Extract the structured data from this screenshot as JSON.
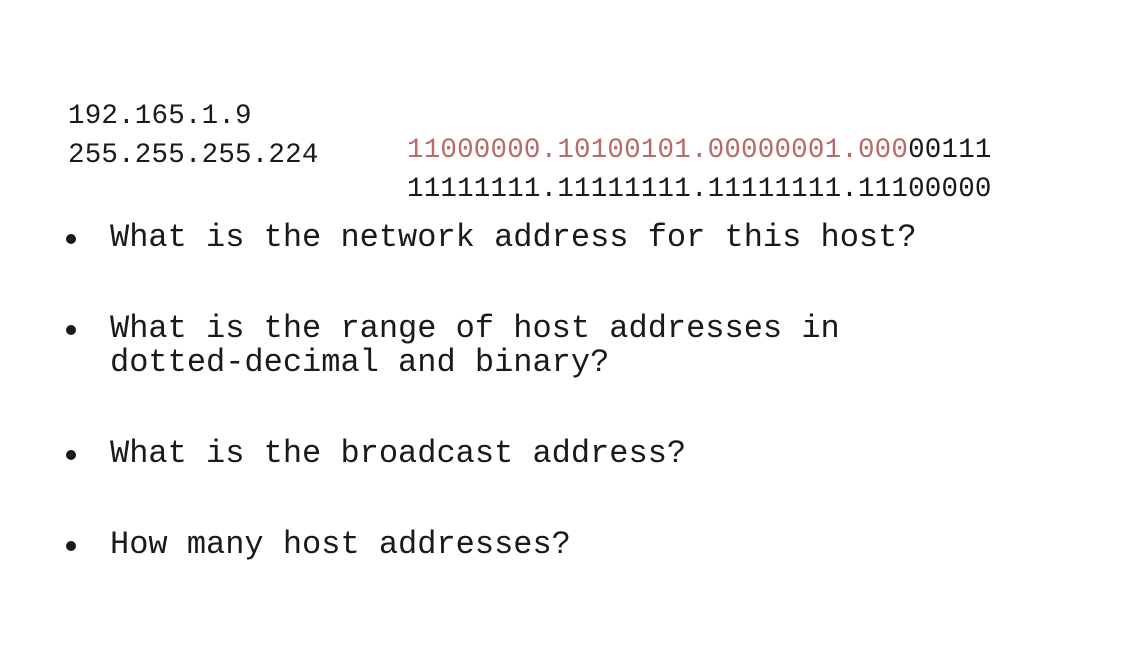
{
  "ip": {
    "decimal": "192.165.1.9",
    "binary_network_part": "11000000.10100101.00000001.000",
    "binary_host_part": "00111"
  },
  "mask": {
    "decimal": "255.255.255.224",
    "binary": "11111111.11111111.11111111.11100000"
  },
  "colors": {
    "network_bits": "#b86a6a",
    "text": "#1a1a1a",
    "background": "#ffffff"
  },
  "questions": [
    {
      "line1": "What is the network address for this host?",
      "line2": ""
    },
    {
      "line1": "What is the range of host addresses in",
      "line2": "dotted-decimal and binary?"
    },
    {
      "line1": "What is the broadcast address?",
      "line2": ""
    },
    {
      "line1": "How many host addresses?",
      "line2": ""
    }
  ]
}
